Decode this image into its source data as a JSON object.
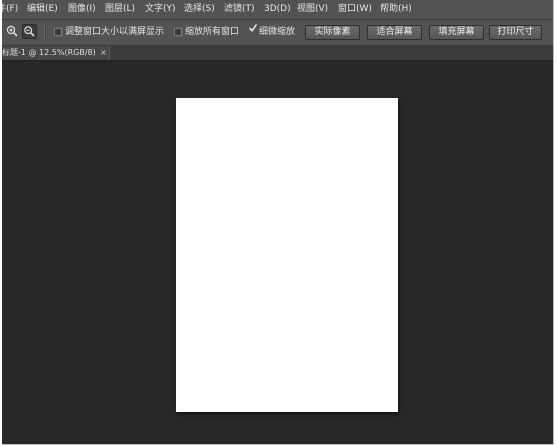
{
  "menubar": {
    "items": [
      {
        "label": "件(F)"
      },
      {
        "label": "编辑(E)"
      },
      {
        "label": "图像(I)"
      },
      {
        "label": "图层(L)"
      },
      {
        "label": "文字(Y)"
      },
      {
        "label": "选择(S)"
      },
      {
        "label": "滤镜(T)"
      },
      {
        "label": "3D(D)"
      },
      {
        "label": "视图(V)"
      },
      {
        "label": "窗口(W)"
      },
      {
        "label": "帮助(H)"
      }
    ]
  },
  "options": {
    "zoom_in_icon": "zoom-in-icon",
    "zoom_out_icon": "zoom-out-icon",
    "resize_windows_label": "调整窗口大小以满屏显示",
    "resize_windows_checked": false,
    "zoom_all_label": "缩放所有窗口",
    "zoom_all_checked": false,
    "scrubby_zoom_label": "细微缩放",
    "scrubby_zoom_checked": true,
    "actual_pixels_label": "实际像素",
    "fit_screen_label": "适合屏幕",
    "fill_screen_label": "填充屏幕",
    "print_size_label": "打印尺寸"
  },
  "document_tab": {
    "title": "标题-1 @ 12.5%(RGB/8)",
    "close_label": "×"
  },
  "canvas": {
    "background_color": "#282828",
    "document_color": "#ffffff"
  }
}
